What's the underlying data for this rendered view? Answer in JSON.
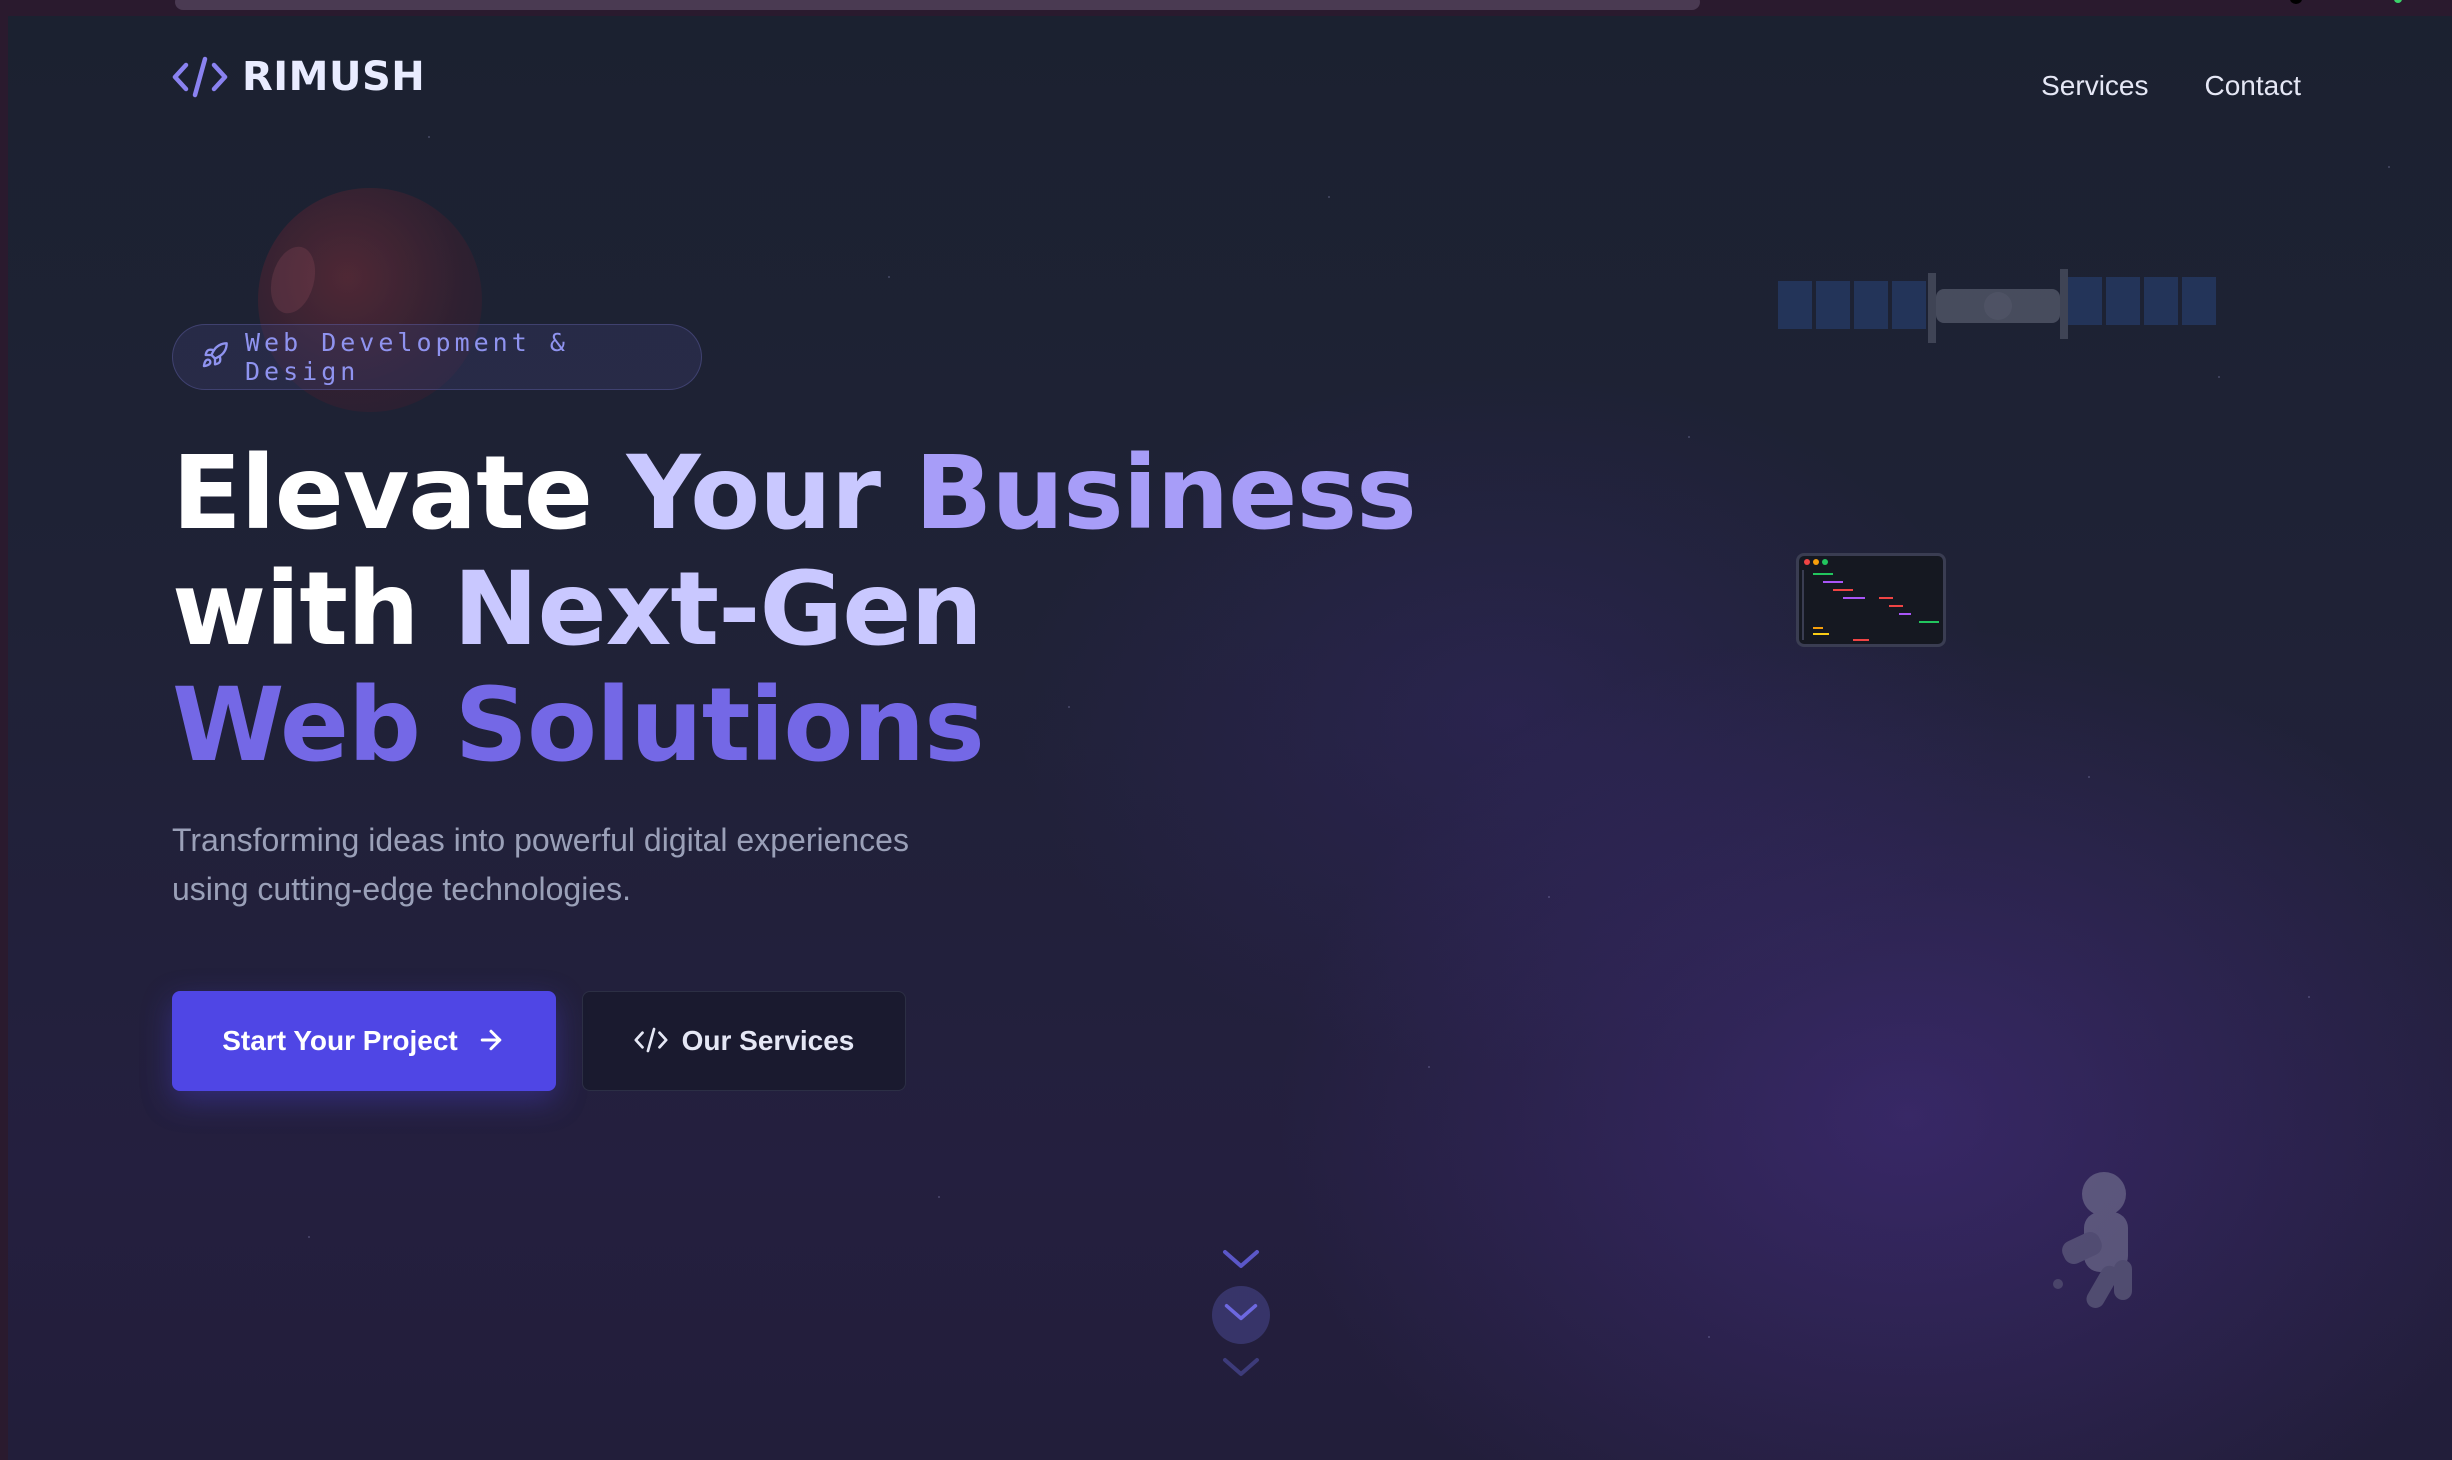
{
  "nav": {
    "brand": "RIMUSH",
    "links": [
      {
        "label": "Services"
      },
      {
        "label": "Contact"
      }
    ]
  },
  "hero": {
    "badge": "Web Development & Design",
    "headline": {
      "line1_a": "Elevate ",
      "line1_b": "Your ",
      "line1_c": "Business",
      "line2_a": "with ",
      "line2_b": "Next-Gen",
      "line3": "Web Solutions"
    },
    "subtitle_line1": "Transforming ideas into powerful digital experiences",
    "subtitle_line2": "using cutting-edge technologies.",
    "primary_cta": "Start Your Project",
    "secondary_cta": "Our Services"
  },
  "icons": {
    "logo": "code-brackets-icon",
    "badge": "rocket-icon",
    "primary_cta": "arrow-right-icon",
    "secondary_cta": "code-brackets-icon",
    "scroll": "chevron-down-icon"
  },
  "colors": {
    "accent": "#4f46e5",
    "accent_light": "#8a82f0",
    "background": "#1f2236",
    "text": "#ffffff"
  }
}
